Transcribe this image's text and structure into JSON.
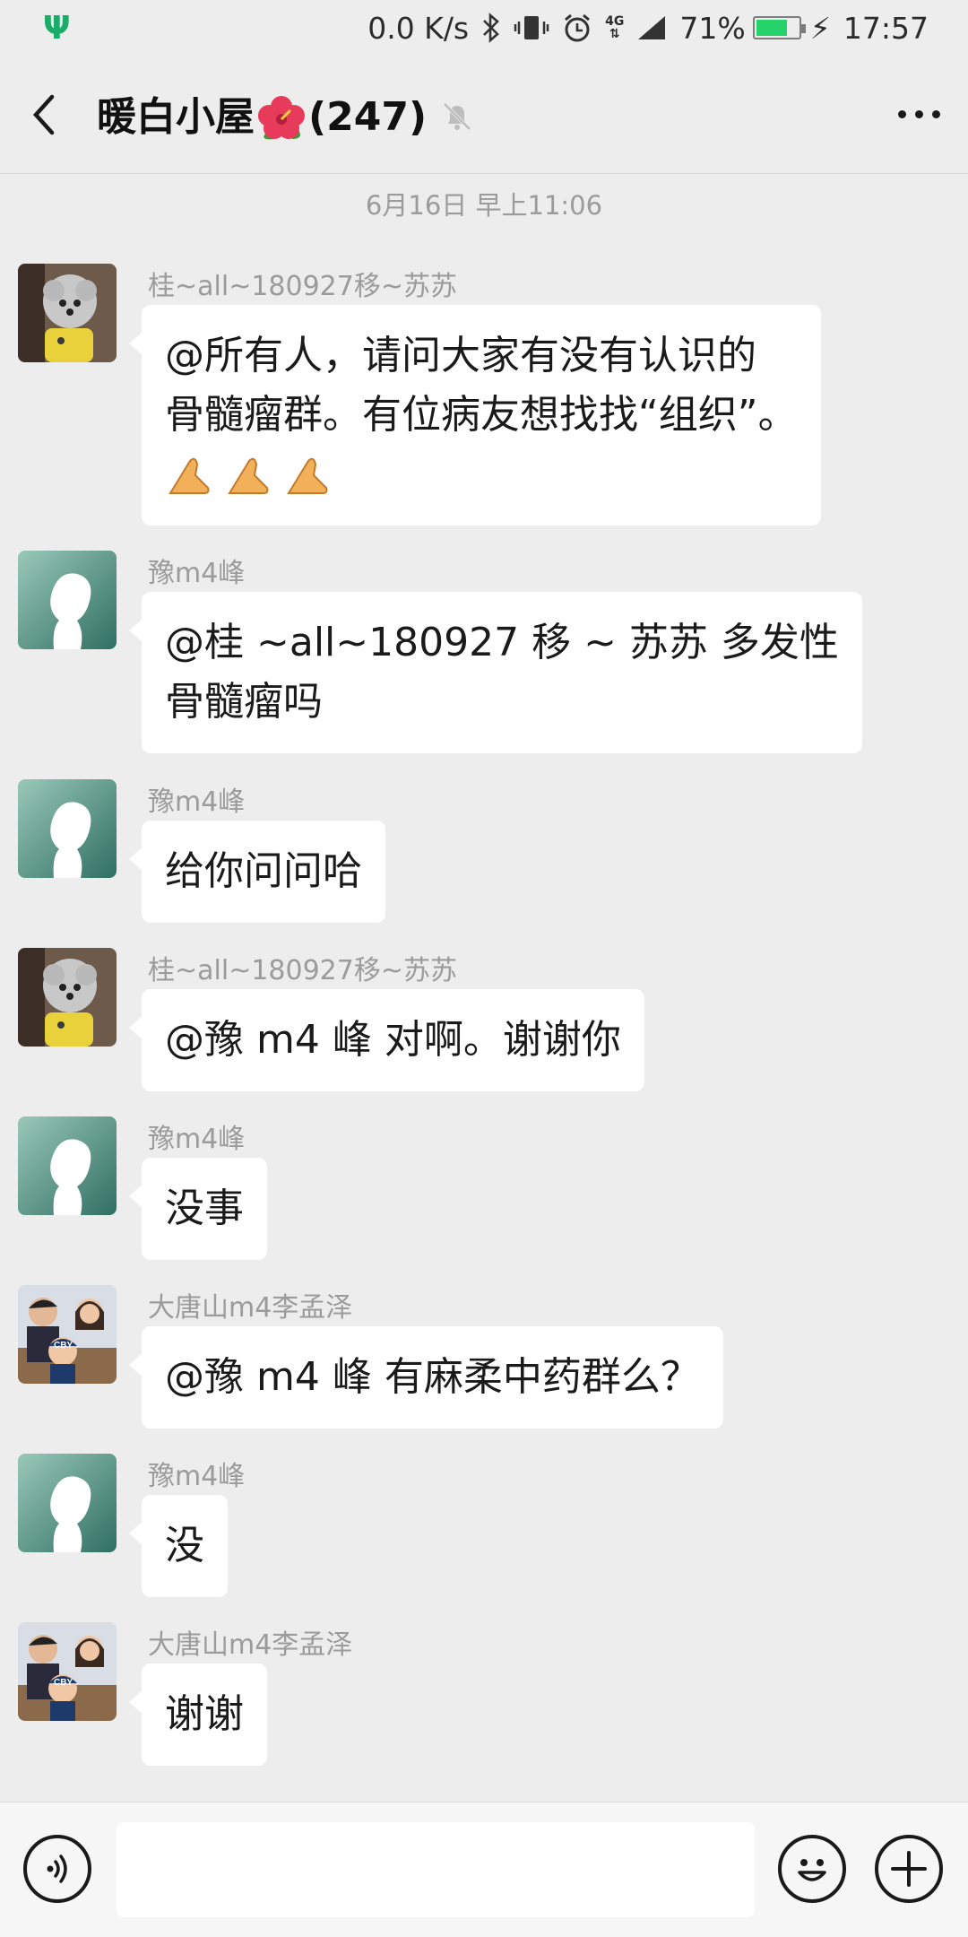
{
  "status_bar": {
    "usb_icon": "usb-icon",
    "net_speed": "0.0 K/s",
    "network": "4G",
    "battery": "71%",
    "battery_fraction": 0.71,
    "time": "17:57"
  },
  "header": {
    "title_prefix": "暖白小屋",
    "title_suffix": "(247)",
    "back_icon": "chevron-left-icon",
    "mute_icon": "bell-muted-icon",
    "more_icon": "more-dots-icon"
  },
  "chat": {
    "timestamp": "6月16日 早上11:06",
    "messages": [
      {
        "sender": "桂~all~180927移~苏苏",
        "avatar": "poodle",
        "lines": [
          "@所有人，请问大家有没有认识的",
          "骨髓瘤群。有位病友想找找“组织”。"
        ],
        "emoji": "pray-hands"
      },
      {
        "sender": "豫m4峰",
        "avatar": "silhouette",
        "lines": [
          "@桂 ~all~180927 移 ~ 苏苏  多发性",
          "骨髓瘤吗"
        ]
      },
      {
        "sender": "豫m4峰",
        "avatar": "silhouette",
        "lines": [
          "给你问问哈"
        ]
      },
      {
        "sender": "桂~all~180927移~苏苏",
        "avatar": "poodle",
        "lines": [
          "@豫 m4 峰  对啊。谢谢你"
        ]
      },
      {
        "sender": "豫m4峰",
        "avatar": "silhouette",
        "lines": [
          "没事"
        ]
      },
      {
        "sender": "大唐山m4李孟泽",
        "avatar": "family",
        "lines": [
          "@豫 m4 峰  有麻柔中药群么？"
        ]
      },
      {
        "sender": "豫m4峰",
        "avatar": "silhouette",
        "lines": [
          "没"
        ]
      },
      {
        "sender": "大唐山m4李孟泽",
        "avatar": "family",
        "lines": [
          "谢谢"
        ]
      }
    ]
  },
  "input_bar": {
    "voice_icon": "voice-icon",
    "emoji_icon": "emoji-icon",
    "plus_icon": "plus-icon",
    "text_value": ""
  }
}
